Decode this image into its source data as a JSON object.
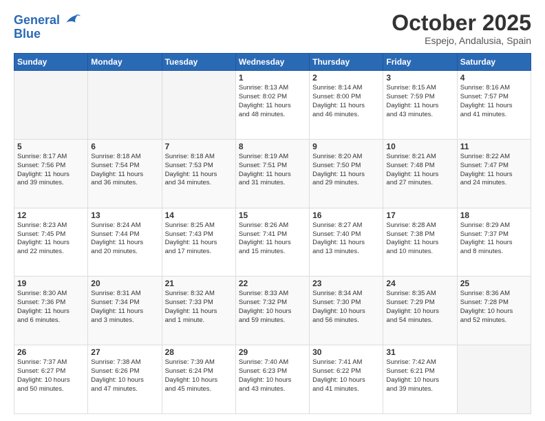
{
  "logo": {
    "line1": "General",
    "line2": "Blue"
  },
  "header": {
    "month": "October 2025",
    "location": "Espejo, Andalusia, Spain"
  },
  "weekdays": [
    "Sunday",
    "Monday",
    "Tuesday",
    "Wednesday",
    "Thursday",
    "Friday",
    "Saturday"
  ],
  "weeks": [
    [
      {
        "day": "",
        "info": ""
      },
      {
        "day": "",
        "info": ""
      },
      {
        "day": "",
        "info": ""
      },
      {
        "day": "1",
        "info": "Sunrise: 8:13 AM\nSunset: 8:02 PM\nDaylight: 11 hours\nand 48 minutes."
      },
      {
        "day": "2",
        "info": "Sunrise: 8:14 AM\nSunset: 8:00 PM\nDaylight: 11 hours\nand 46 minutes."
      },
      {
        "day": "3",
        "info": "Sunrise: 8:15 AM\nSunset: 7:59 PM\nDaylight: 11 hours\nand 43 minutes."
      },
      {
        "day": "4",
        "info": "Sunrise: 8:16 AM\nSunset: 7:57 PM\nDaylight: 11 hours\nand 41 minutes."
      }
    ],
    [
      {
        "day": "5",
        "info": "Sunrise: 8:17 AM\nSunset: 7:56 PM\nDaylight: 11 hours\nand 39 minutes."
      },
      {
        "day": "6",
        "info": "Sunrise: 8:18 AM\nSunset: 7:54 PM\nDaylight: 11 hours\nand 36 minutes."
      },
      {
        "day": "7",
        "info": "Sunrise: 8:18 AM\nSunset: 7:53 PM\nDaylight: 11 hours\nand 34 minutes."
      },
      {
        "day": "8",
        "info": "Sunrise: 8:19 AM\nSunset: 7:51 PM\nDaylight: 11 hours\nand 31 minutes."
      },
      {
        "day": "9",
        "info": "Sunrise: 8:20 AM\nSunset: 7:50 PM\nDaylight: 11 hours\nand 29 minutes."
      },
      {
        "day": "10",
        "info": "Sunrise: 8:21 AM\nSunset: 7:48 PM\nDaylight: 11 hours\nand 27 minutes."
      },
      {
        "day": "11",
        "info": "Sunrise: 8:22 AM\nSunset: 7:47 PM\nDaylight: 11 hours\nand 24 minutes."
      }
    ],
    [
      {
        "day": "12",
        "info": "Sunrise: 8:23 AM\nSunset: 7:45 PM\nDaylight: 11 hours\nand 22 minutes."
      },
      {
        "day": "13",
        "info": "Sunrise: 8:24 AM\nSunset: 7:44 PM\nDaylight: 11 hours\nand 20 minutes."
      },
      {
        "day": "14",
        "info": "Sunrise: 8:25 AM\nSunset: 7:43 PM\nDaylight: 11 hours\nand 17 minutes."
      },
      {
        "day": "15",
        "info": "Sunrise: 8:26 AM\nSunset: 7:41 PM\nDaylight: 11 hours\nand 15 minutes."
      },
      {
        "day": "16",
        "info": "Sunrise: 8:27 AM\nSunset: 7:40 PM\nDaylight: 11 hours\nand 13 minutes."
      },
      {
        "day": "17",
        "info": "Sunrise: 8:28 AM\nSunset: 7:38 PM\nDaylight: 11 hours\nand 10 minutes."
      },
      {
        "day": "18",
        "info": "Sunrise: 8:29 AM\nSunset: 7:37 PM\nDaylight: 11 hours\nand 8 minutes."
      }
    ],
    [
      {
        "day": "19",
        "info": "Sunrise: 8:30 AM\nSunset: 7:36 PM\nDaylight: 11 hours\nand 6 minutes."
      },
      {
        "day": "20",
        "info": "Sunrise: 8:31 AM\nSunset: 7:34 PM\nDaylight: 11 hours\nand 3 minutes."
      },
      {
        "day": "21",
        "info": "Sunrise: 8:32 AM\nSunset: 7:33 PM\nDaylight: 11 hours\nand 1 minute."
      },
      {
        "day": "22",
        "info": "Sunrise: 8:33 AM\nSunset: 7:32 PM\nDaylight: 10 hours\nand 59 minutes."
      },
      {
        "day": "23",
        "info": "Sunrise: 8:34 AM\nSunset: 7:30 PM\nDaylight: 10 hours\nand 56 minutes."
      },
      {
        "day": "24",
        "info": "Sunrise: 8:35 AM\nSunset: 7:29 PM\nDaylight: 10 hours\nand 54 minutes."
      },
      {
        "day": "25",
        "info": "Sunrise: 8:36 AM\nSunset: 7:28 PM\nDaylight: 10 hours\nand 52 minutes."
      }
    ],
    [
      {
        "day": "26",
        "info": "Sunrise: 7:37 AM\nSunset: 6:27 PM\nDaylight: 10 hours\nand 50 minutes."
      },
      {
        "day": "27",
        "info": "Sunrise: 7:38 AM\nSunset: 6:26 PM\nDaylight: 10 hours\nand 47 minutes."
      },
      {
        "day": "28",
        "info": "Sunrise: 7:39 AM\nSunset: 6:24 PM\nDaylight: 10 hours\nand 45 minutes."
      },
      {
        "day": "29",
        "info": "Sunrise: 7:40 AM\nSunset: 6:23 PM\nDaylight: 10 hours\nand 43 minutes."
      },
      {
        "day": "30",
        "info": "Sunrise: 7:41 AM\nSunset: 6:22 PM\nDaylight: 10 hours\nand 41 minutes."
      },
      {
        "day": "31",
        "info": "Sunrise: 7:42 AM\nSunset: 6:21 PM\nDaylight: 10 hours\nand 39 minutes."
      },
      {
        "day": "",
        "info": ""
      }
    ]
  ]
}
